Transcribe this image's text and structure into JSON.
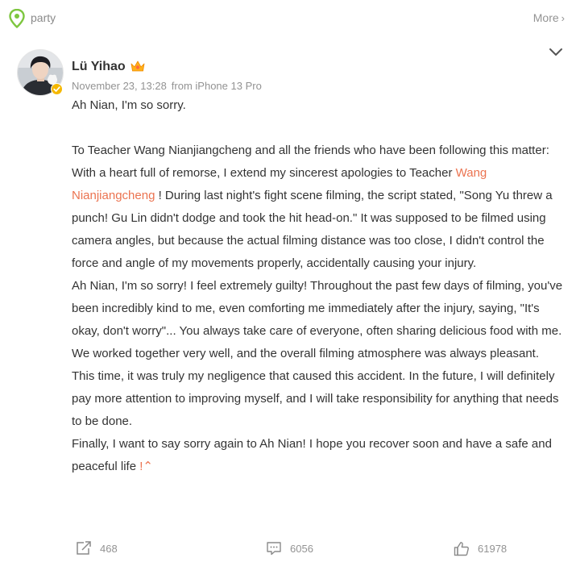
{
  "header": {
    "topic": "party",
    "more_label": "More",
    "more_chevron": "›"
  },
  "post": {
    "author": "Lü Yihao",
    "timestamp": "November 23, 13:28",
    "source": "from iPhone 13 Pro",
    "paragraphs": {
      "p1": "Ah Nian, I'm so sorry.",
      "p2": "To Teacher Wang Nianjiangcheng and all the friends who have been following this matter:",
      "p3_before": "With a heart full of remorse, I extend my sincerest apologies to Teacher ",
      "p3_mention": "Wang Nianjiangcheng",
      "p3_after": " ! During last night's fight scene filming, the script stated, \"Song Yu threw a punch! Gu Lin didn't dodge and took the hit head-on.\" It was supposed to be filmed using camera angles, but because the actual filming distance was too close, I didn't control the force and angle of my movements properly, accidentally causing your injury.",
      "p4": "Ah Nian, I'm so sorry! I feel extremely guilty! Throughout the past few days of filming, you've been incredibly kind to me, even comforting me immediately after the injury, saying, \"It's okay, don't worry\"... You always take care of everyone, often sharing delicious food with me. We worked together very well, and the overall filming atmosphere was always pleasant. This time, it was truly my negligence that caused this accident. In the future, I will definitely pay more attention to improving myself, and I will take responsibility for anything that needs to be done.",
      "p5": "Finally, I want to say sorry again to Ah Nian! I hope you recover soon and have a safe and peaceful life ",
      "p5_collapse": "!⌃"
    }
  },
  "actions": {
    "reposts": "468",
    "comments": "6056",
    "likes": "61978"
  },
  "icons": {
    "topic": "location-pin-icon",
    "collapse": "chevron-down-icon",
    "verified": "verified-badge-icon",
    "user_badge": "crown-badge-icon",
    "repost": "share-arrow-icon",
    "comment": "comment-icon",
    "like": "thumbs-up-icon"
  },
  "colors": {
    "accent": "#eb7350",
    "topic_green": "#7dc63f",
    "badge_gold": "#f5b800",
    "muted": "#939393"
  }
}
